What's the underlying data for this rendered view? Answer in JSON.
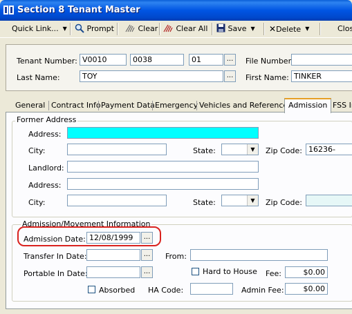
{
  "window": {
    "title": "Section 8 Tenant Master"
  },
  "toolbar": {
    "quick_link": "Quick Link...",
    "prompt": "Prompt",
    "clear": "Clear",
    "clear_all": "Clear All",
    "save": "Save",
    "delete": "Delete",
    "close": "Close"
  },
  "header": {
    "tenant_number_label": "Tenant Number:",
    "tenant_number_1": "V0010",
    "tenant_number_2": "0038",
    "tenant_number_3": "01",
    "file_number_label": "File Number:",
    "file_number": "",
    "last_name_label": "Last Name:",
    "last_name": "TOY",
    "first_name_label": "First Name:",
    "first_name": "TINKER",
    "browse": "..."
  },
  "tabs": [
    {
      "label": "General"
    },
    {
      "label": "Contract Info"
    },
    {
      "label": "Payment Data"
    },
    {
      "label": "Emergency"
    },
    {
      "label": "Vehicles and References"
    },
    {
      "label": "Admission"
    },
    {
      "label": "FSS In"
    }
  ],
  "former_address": {
    "title": "Former Address",
    "address_label": "Address:",
    "address": "",
    "city_label": "City:",
    "city": "",
    "state_label": "State:",
    "state": "",
    "zip_label": "Zip Code:",
    "zip": "16236-",
    "landlord_label": "Landlord:",
    "landlord": "",
    "address2_label": "Address:",
    "address2": "",
    "city2_label": "City:",
    "city2": "",
    "state2_label": "State:",
    "state2": "",
    "zip2_label": "Zip Code:",
    "zip2": ""
  },
  "admission": {
    "title": "Admission/Movement Information",
    "admission_date_label": "Admission Date:",
    "admission_date": "12/08/1999",
    "transfer_in_label": "Transfer In Date:",
    "transfer_in": "",
    "from_label": "From:",
    "from": "",
    "portable_in_label": "Portable In Date:",
    "portable_in": "",
    "hard_to_house_label": "Hard to House",
    "fee_label": "Fee:",
    "fee": "$0.00",
    "absorbed_label": "Absorbed",
    "ha_code_label": "HA Code:",
    "ha_code": "",
    "admin_fee_label": "Admin Fee:",
    "admin_fee": "$0.00"
  },
  "colors": {
    "title_bar": "#0055e3",
    "highlight": "#d9221e",
    "address_field": "#00ffff",
    "zip2_field": "#e6f7f7"
  }
}
